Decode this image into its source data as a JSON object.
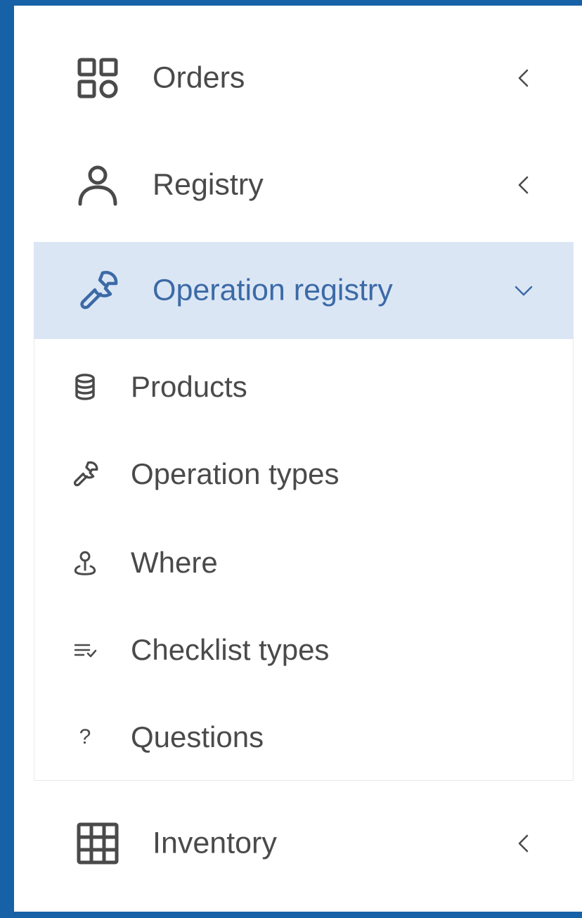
{
  "colors": {
    "frame": "#1761a6",
    "active_bg": "#dbe6f5",
    "active_text": "#3c6aa6",
    "text": "#4a4a4a"
  },
  "menu": {
    "orders": {
      "label": "Orders",
      "icon": "grid-apps-icon",
      "state": "collapsed"
    },
    "registry": {
      "label": "Registry",
      "icon": "user-icon",
      "state": "collapsed"
    },
    "operation_registry": {
      "label": "Operation registry",
      "icon": "wrench-icon",
      "state": "expanded",
      "active": true,
      "children": [
        {
          "label": "Products",
          "icon": "database-icon"
        },
        {
          "label": "Operation types",
          "icon": "wrench-icon"
        },
        {
          "label": "Where",
          "icon": "location-pin-icon"
        },
        {
          "label": "Checklist types",
          "icon": "checklist-icon"
        },
        {
          "label": "Questions",
          "icon": "question-icon"
        }
      ]
    },
    "inventory": {
      "label": "Inventory",
      "icon": "table-grid-icon",
      "state": "collapsed"
    }
  }
}
